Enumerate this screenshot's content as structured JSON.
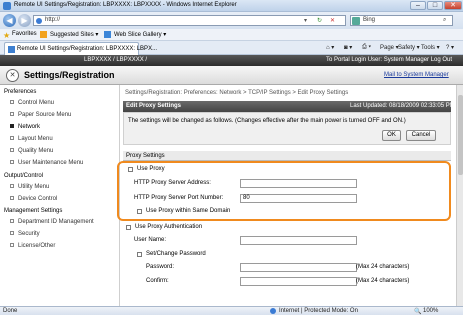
{
  "window": {
    "title": "Remote UI Settings/Registration: LBPXXXX: LBPXXXX - Windows Internet Explorer",
    "buttons": [
      "–",
      "□",
      "✕"
    ]
  },
  "address": {
    "url": "http://",
    "search_engine": "Bing",
    "back": "◀",
    "forward": "▶"
  },
  "favorites": {
    "label": "Favorites",
    "items": [
      "Suggested Sites ▾",
      "Web Slice Gallery ▾"
    ]
  },
  "tab": {
    "label": "Remote UI Settings/Registration: LBPXXXX: LBPX..."
  },
  "command_bar": {
    "items": [
      "Page ▾",
      "Safety ▾",
      "Tools ▾"
    ]
  },
  "device": {
    "name": "LBPXXXX / LBPXXXX /",
    "login": "To Portal  Login User: System Manager Log Out"
  },
  "app": {
    "title": "Settings/Registration",
    "mail": "Mail to System Manager"
  },
  "sidebar": {
    "preferences": "Preferences",
    "pref_items": [
      {
        "label": "Control Menu",
        "active": false
      },
      {
        "label": "Paper Source Menu",
        "active": false
      },
      {
        "label": "Network",
        "active": true
      },
      {
        "label": "Layout Menu",
        "active": false
      },
      {
        "label": "Quality Menu",
        "active": false
      },
      {
        "label": "User Maintenance Menu",
        "active": false
      }
    ],
    "output": "Output/Control",
    "output_items": [
      {
        "label": "Utility Menu"
      },
      {
        "label": "Device Control"
      }
    ],
    "management": "Management Settings",
    "mgmt_items": [
      {
        "label": "Department ID Management"
      },
      {
        "label": "Security"
      },
      {
        "label": "License/Other"
      }
    ]
  },
  "main": {
    "breadcrumb": "Settings/Registration: Preferences: Network > TCP/IP Settings > Edit Proxy Settings",
    "edit_title": "Edit Proxy Settings",
    "last_updated": "Last Updated: 08/18/2009 02:33:05 PM",
    "notice": "The settings will be changed as follows. (Changes effective after the main power is turned OFF and ON.)",
    "ok": "OK",
    "cancel": "Cancel",
    "section": "Proxy Settings",
    "use_proxy": "Use Proxy",
    "server_address_label": "HTTP Proxy Server Address:",
    "server_address_value": "",
    "port_label": "HTTP Proxy Server Port Number:",
    "port_value": "80",
    "same_domain": "Use Proxy within Same Domain",
    "use_auth": "Use Proxy Authentication",
    "user_name_label": "User Name:",
    "user_name_value": "",
    "set_change_pw": "Set/Change Password",
    "password_label": "Password:",
    "password_hint": "(Max 24 characters)",
    "confirm_label": "Confirm:",
    "confirm_hint": "(Max 24 characters)"
  },
  "status": {
    "left": "Done",
    "zone": "Internet | Protected Mode: On",
    "zoom": "100%"
  }
}
